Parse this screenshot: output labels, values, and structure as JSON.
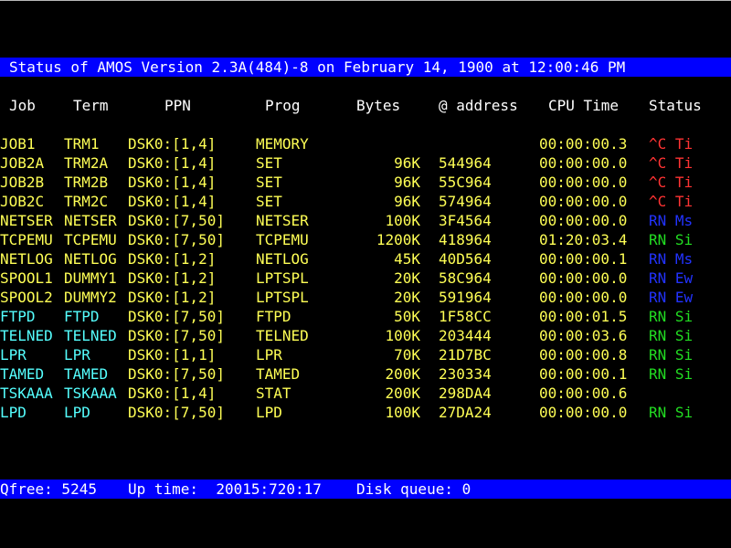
{
  "banner": {
    "title": "Status of AMOS Version 2.3A(484)-8 on February 14, 1900 at 12:00:46 PM"
  },
  "columns": {
    "job": "Job",
    "term": "Term",
    "ppn": "PPN",
    "prog": "Prog",
    "bytes": "Bytes",
    "address": "@ address",
    "cpu": "CPU Time",
    "status": "Status"
  },
  "colors": {
    "yellow": "#ffff55",
    "cyan": "#55ffff",
    "red": "#ff3333",
    "blue": "#2233ff",
    "green": "#22dd22",
    "header_bar": "#0000ff",
    "white": "#ffffff"
  },
  "jobs": [
    {
      "job": "JOB1",
      "term": "TRM1",
      "ppn": "DSK0:[1,4]",
      "prog": "MEMORY",
      "bytes": "",
      "address": "",
      "cpu": "00:00:00.3",
      "status": "^C Ti",
      "name_color": "yellow",
      "status_color": "red"
    },
    {
      "job": "JOB2A",
      "term": "TRM2A",
      "ppn": "DSK0:[1,4]",
      "prog": "SET",
      "bytes": "96K",
      "address": "544964",
      "cpu": "00:00:00.0",
      "status": "^C Ti",
      "name_color": "yellow",
      "status_color": "red"
    },
    {
      "job": "JOB2B",
      "term": "TRM2B",
      "ppn": "DSK0:[1,4]",
      "prog": "SET",
      "bytes": "96K",
      "address": "55C964",
      "cpu": "00:00:00.0",
      "status": "^C Ti",
      "name_color": "yellow",
      "status_color": "red"
    },
    {
      "job": "JOB2C",
      "term": "TRM2C",
      "ppn": "DSK0:[1,4]",
      "prog": "SET",
      "bytes": "96K",
      "address": "574964",
      "cpu": "00:00:00.0",
      "status": "^C Ti",
      "name_color": "yellow",
      "status_color": "red"
    },
    {
      "job": "NETSER",
      "term": "NETSER",
      "ppn": "DSK0:[7,50]",
      "prog": "NETSER",
      "bytes": "100K",
      "address": "3F4564",
      "cpu": "00:00:00.0",
      "status": "RN Ms",
      "name_color": "yellow",
      "status_color": "blue"
    },
    {
      "job": "TCPEMU",
      "term": "TCPEMU",
      "ppn": "DSK0:[7,50]",
      "prog": "TCPEMU",
      "bytes": "1200K",
      "address": "418964",
      "cpu": "01:20:03.4",
      "status": "RN Si",
      "name_color": "yellow",
      "status_color": "green"
    },
    {
      "job": "NETLOG",
      "term": "NETLOG",
      "ppn": "DSK0:[1,2]",
      "prog": "NETLOG",
      "bytes": "45K",
      "address": "40D564",
      "cpu": "00:00:00.1",
      "status": "RN Ms",
      "name_color": "yellow",
      "status_color": "blue"
    },
    {
      "job": "SPOOL1",
      "term": "DUMMY1",
      "ppn": "DSK0:[1,2]",
      "prog": "LPTSPL",
      "bytes": "20K",
      "address": "58C964",
      "cpu": "00:00:00.0",
      "status": "RN Ew",
      "name_color": "yellow",
      "status_color": "blue"
    },
    {
      "job": "SPOOL2",
      "term": "DUMMY2",
      "ppn": "DSK0:[1,2]",
      "prog": "LPTSPL",
      "bytes": "20K",
      "address": "591964",
      "cpu": "00:00:00.0",
      "status": "RN Ew",
      "name_color": "yellow",
      "status_color": "blue"
    },
    {
      "job": "FTPD",
      "term": "FTPD",
      "ppn": "DSK0:[7,50]",
      "prog": "FTPD",
      "bytes": "50K",
      "address": "1F58CC",
      "cpu": "00:00:01.5",
      "status": "RN Si",
      "name_color": "cyan",
      "status_color": "green"
    },
    {
      "job": "TELNED",
      "term": "TELNED",
      "ppn": "DSK0:[7,50]",
      "prog": "TELNED",
      "bytes": "100K",
      "address": "203444",
      "cpu": "00:00:03.6",
      "status": "RN Si",
      "name_color": "cyan",
      "status_color": "green"
    },
    {
      "job": "LPR",
      "term": "LPR",
      "ppn": "DSK0:[1,1]",
      "prog": "LPR",
      "bytes": "70K",
      "address": "21D7BC",
      "cpu": "00:00:00.8",
      "status": "RN Si",
      "name_color": "cyan",
      "status_color": "green"
    },
    {
      "job": "TAMED",
      "term": "TAMED",
      "ppn": "DSK0:[7,50]",
      "prog": "TAMED",
      "bytes": "200K",
      "address": "230334",
      "cpu": "00:00:00.1",
      "status": "RN Si",
      "name_color": "cyan",
      "status_color": "green"
    },
    {
      "job": "TSKAAA",
      "term": "TSKAAA",
      "ppn": "DSK0:[1,4]",
      "prog": "STAT",
      "bytes": "200K",
      "address": "298DA4",
      "cpu": "00:00:00.6",
      "status": "",
      "name_color": "cyan",
      "status_color": "green"
    },
    {
      "job": "LPD",
      "term": "LPD",
      "ppn": "DSK0:[7,50]",
      "prog": "LPD",
      "bytes": "100K",
      "address": "27DA24",
      "cpu": "00:00:00.0",
      "status": "RN Si",
      "name_color": "cyan",
      "status_color": "green"
    }
  ],
  "footer": {
    "qfree": "Qfree: 5245",
    "uptime": "Up time:  20015:720:17",
    "disk_queue": "Disk queue: 0"
  }
}
